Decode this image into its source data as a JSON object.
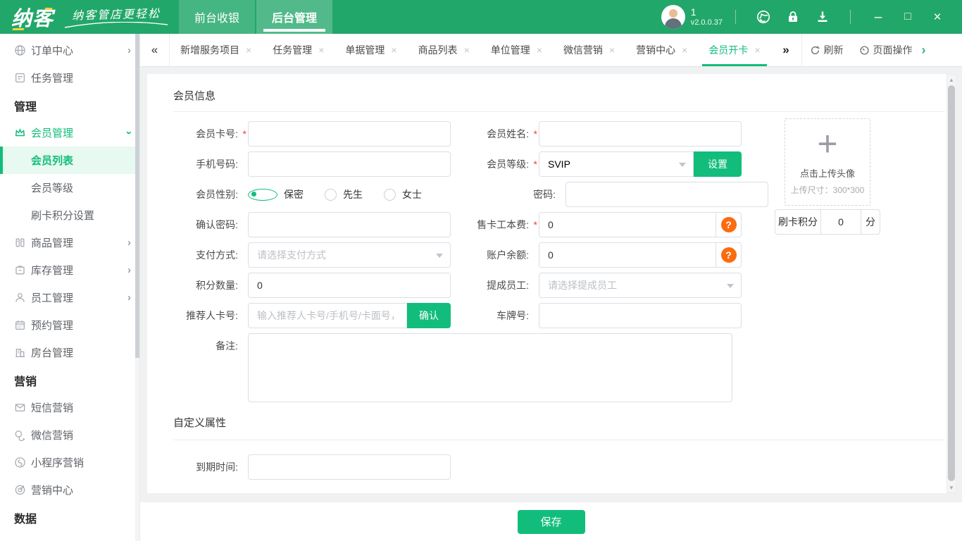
{
  "colors": {
    "brand_green": "#22a76a",
    "accent_green": "#12bd7b",
    "active_bg": "#e7f9f0",
    "help_orange": "#fb6c10",
    "required_red": "#f1403c",
    "input_border": "#dcdfe6"
  },
  "glyphs": {
    "chevron_right": "›",
    "collapse_left": "«",
    "collapse_right": "»",
    "close_tab": "×",
    "minimize": "–",
    "maximize": "□",
    "close_win": "×",
    "plus": "+",
    "arrow_up": "▲",
    "arrow_down": "▼",
    "help": "?",
    "star": "*"
  },
  "topbar": {
    "logo": "纳客",
    "slogan": "纳客管店更轻松",
    "nav": {
      "front": "前台收银",
      "back": "后台管理"
    },
    "user_badge": "1",
    "version": "v2.0.0.37"
  },
  "sidebar": {
    "items": [
      {
        "label": "订单中心"
      },
      {
        "label": "任务管理"
      },
      {
        "label": "管理"
      },
      {
        "label": "会员管理"
      },
      {
        "label": "会员列表"
      },
      {
        "label": "会员等级"
      },
      {
        "label": "刷卡积分设置"
      },
      {
        "label": "商品管理"
      },
      {
        "label": "库存管理"
      },
      {
        "label": "员工管理"
      },
      {
        "label": "预约管理"
      },
      {
        "label": "房台管理"
      },
      {
        "label": "营销"
      },
      {
        "label": "短信营销"
      },
      {
        "label": "微信营销"
      },
      {
        "label": "小程序营销"
      },
      {
        "label": "营销中心"
      },
      {
        "label": "数据"
      }
    ]
  },
  "tabbar": {
    "tabs": [
      {
        "label": "新增服务项目"
      },
      {
        "label": "任务管理"
      },
      {
        "label": "单据管理"
      },
      {
        "label": "商品列表"
      },
      {
        "label": "单位管理"
      },
      {
        "label": "微信营销"
      },
      {
        "label": "营销中心"
      },
      {
        "label": "会员开卡"
      }
    ],
    "refresh_label": "刷新",
    "page_ops_label": "页面操作"
  },
  "form": {
    "title": "会员信息",
    "custom_title": "自定义属性",
    "rows": {
      "card_no": {
        "label": "会员卡号:",
        "value": ""
      },
      "name": {
        "label": "会员姓名:",
        "value": ""
      },
      "phone": {
        "label": "手机号码:",
        "value": ""
      },
      "level": {
        "label": "会员等级:",
        "value": "SVIP",
        "set_btn": "设置"
      },
      "gender": {
        "label": "会员性别:",
        "options": [
          "保密",
          "先生",
          "女士"
        ],
        "selected": "保密"
      },
      "password": {
        "label": "密码:",
        "value": ""
      },
      "confirm_password": {
        "label": "确认密码:",
        "value": ""
      },
      "card_fee": {
        "label": "售卡工本费:",
        "value": "0"
      },
      "payment": {
        "label": "支付方式:",
        "placeholder": "请选择支付方式"
      },
      "balance": {
        "label": "账户余额:",
        "value": "0"
      },
      "points": {
        "label": "积分数量:",
        "value": "0"
      },
      "commission_staff": {
        "label": "提成员工:",
        "placeholder": "请选择提成员工"
      },
      "referrer": {
        "label": "推荐人卡号:",
        "placeholder": "输入推荐人卡号/手机号/卡面号，",
        "confirm_btn": "确认"
      },
      "plate": {
        "label": "车牌号:",
        "value": ""
      },
      "remark": {
        "label": "备注:",
        "value": ""
      },
      "expire": {
        "label": "到期时间:",
        "value": ""
      }
    },
    "upload": {
      "line1": "点击上传头像",
      "line2": "上传尺寸：300*300"
    },
    "swipe_points": {
      "label": "刷卡积分",
      "value": "0",
      "unit": "分"
    }
  },
  "footer": {
    "save": "保存"
  }
}
